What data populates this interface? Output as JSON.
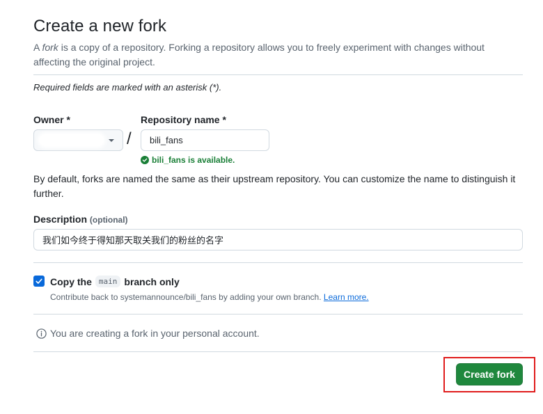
{
  "page": {
    "title": "Create a new fork",
    "intro_prefix": "A ",
    "intro_fork_word": "fork",
    "intro_rest": " is a copy of a repository. Forking a repository allows you to freely experiment with changes without affecting the original project.",
    "required_note": "Required fields are marked with an asterisk (*)."
  },
  "owner": {
    "label": "Owner *",
    "value": ""
  },
  "separator": "/",
  "repo": {
    "label": "Repository name *",
    "value": "bili_fans",
    "availability": "bili_fans is available."
  },
  "help_text": "By default, forks are named the same as their upstream repository. You can customize the name to distinguish it further.",
  "description": {
    "label": "Description",
    "optional": "(optional)",
    "value": "我们如今终于得知那天取关我们的粉丝的名字"
  },
  "copy_branch": {
    "checked": true,
    "label_prefix": "Copy the",
    "branch": "main",
    "label_suffix": "branch only",
    "note": "Contribute back to systemannounce/bili_fans by adding your own branch.",
    "learn_more": "Learn more."
  },
  "info_text": "You are creating a fork in your personal account.",
  "create_button": "Create fork",
  "colors": {
    "primary_button": "#1f883d",
    "success": "#1a7f37",
    "link": "#0969da",
    "highlight": "#e01b1b"
  }
}
